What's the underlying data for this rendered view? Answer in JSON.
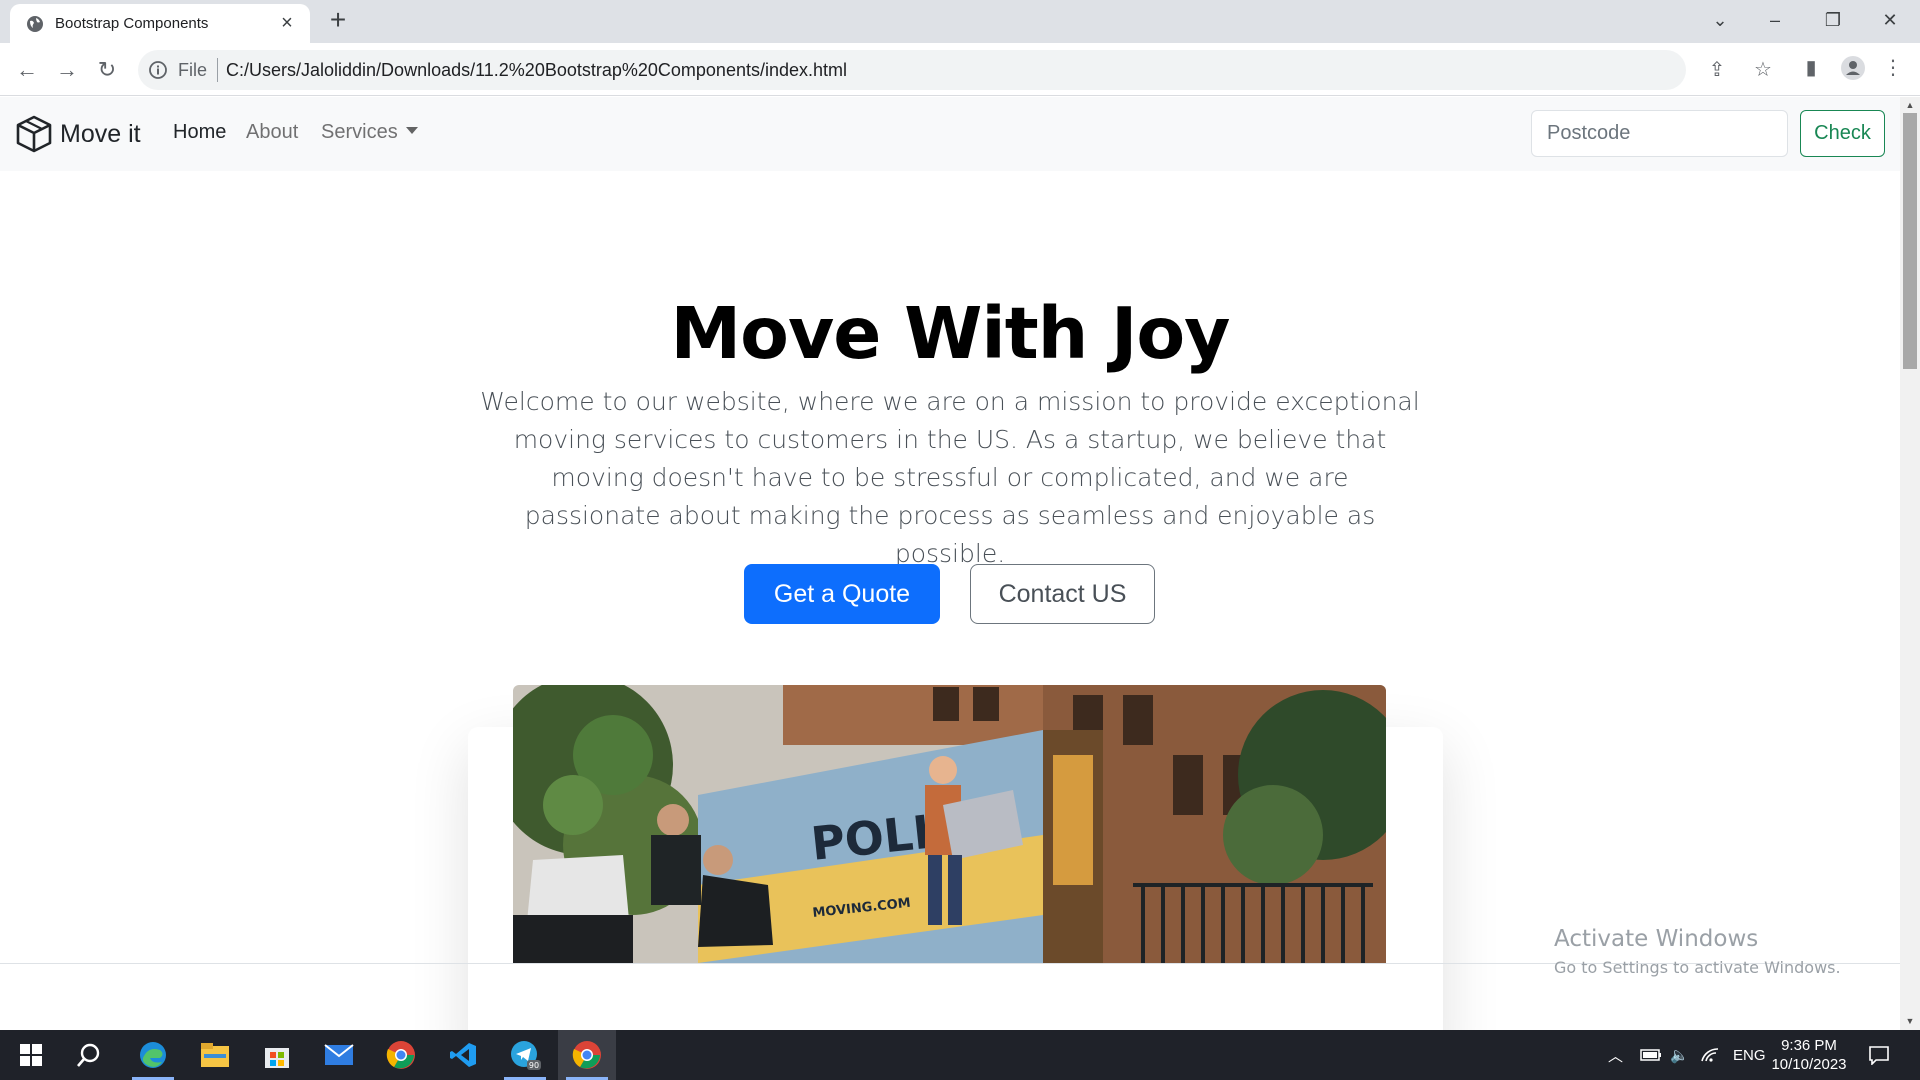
{
  "browser": {
    "tab_title": "Bootstrap Components",
    "omnibox_scheme": "File",
    "omnibox_url": "C:/Users/Jaloliddin/Downloads/11.2%20Bootstrap%20Components/index.html"
  },
  "navbar": {
    "brand": "Move it",
    "links": [
      "Home",
      "About",
      "Services"
    ],
    "postcode_placeholder": "Postcode",
    "check_label": "Check"
  },
  "hero": {
    "title": "Move With Joy",
    "lead": "Welcome to our website, where we are on a mission to provide exceptional moving services to customers in the US. As a startup, we believe that moving doesn't have to be stressful or complicated, and we are passionate about making the process as seamless and enjoyable as possible.",
    "primary_button": "Get a Quote",
    "secondary_button": "Contact US",
    "truck_text": "POLIS",
    "truck_url_text": "MOVING.COM"
  },
  "watermark": {
    "title": "Activate Windows",
    "subtitle": "Go to Settings to activate Windows."
  },
  "taskbar": {
    "language": "ENG",
    "time": "9:36 PM",
    "date": "10/10/2023",
    "telegram_badge": "90"
  },
  "colors": {
    "primary": "#0d6efd",
    "success": "#198754",
    "navbar_bg": "#f8f9fa",
    "taskbar_bg": "#1f2229"
  }
}
